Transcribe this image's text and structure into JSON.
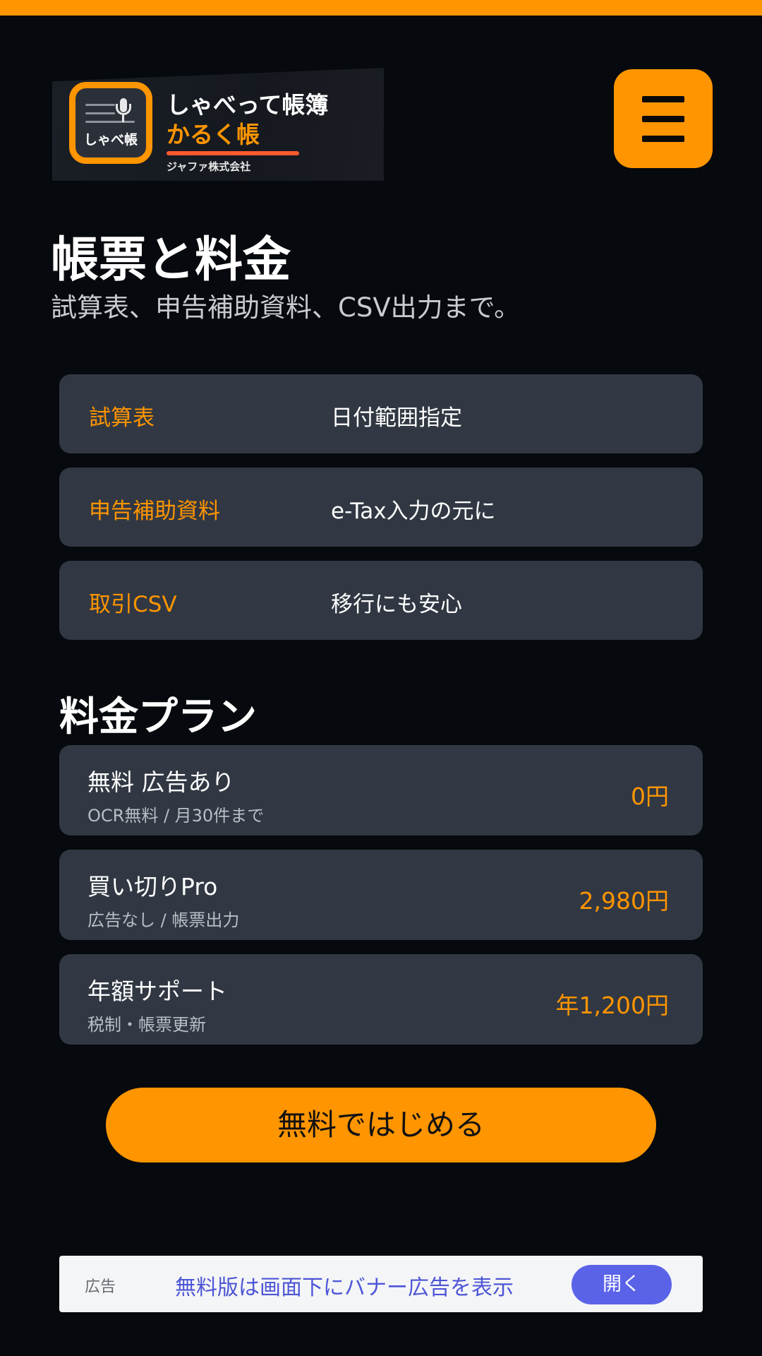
{
  "header": {
    "icon_text": "しゃべ帳",
    "brand_main": "しゃべって帳簿",
    "brand_sub": "かるく帳",
    "company": "ジャファ株式会社",
    "menu_icon": "hamburger-icon"
  },
  "hero": {
    "title": "帳票と料金",
    "subtitle": "試算表、申告補助資料、CSV出力まで。"
  },
  "features": [
    {
      "label": "試算表",
      "value": "日付範囲指定"
    },
    {
      "label": "申告補助資料",
      "value": "e-Tax入力の元に"
    },
    {
      "label": "取引CSV",
      "value": "移行にも安心"
    }
  ],
  "plans": {
    "heading": "料金プラン",
    "items": [
      {
        "name": "無料 広告あり",
        "desc": "OCR無料 / 月30件まで",
        "price": "0円"
      },
      {
        "name": "買い切りPro",
        "desc": "広告なし / 帳票出力",
        "price": "2,980円"
      },
      {
        "name": "年額サポート",
        "desc": "税制・帳票更新",
        "price": "年1,200円"
      }
    ]
  },
  "cta": {
    "label": "無料ではじめる"
  },
  "ad": {
    "label": "広告",
    "text": "無料版は画面下にバナー広告を表示",
    "open_label": "開く"
  },
  "colors": {
    "accent": "#ff9500",
    "background": "#06090d",
    "card": "#313843",
    "ad_accent": "#5a63e8"
  }
}
